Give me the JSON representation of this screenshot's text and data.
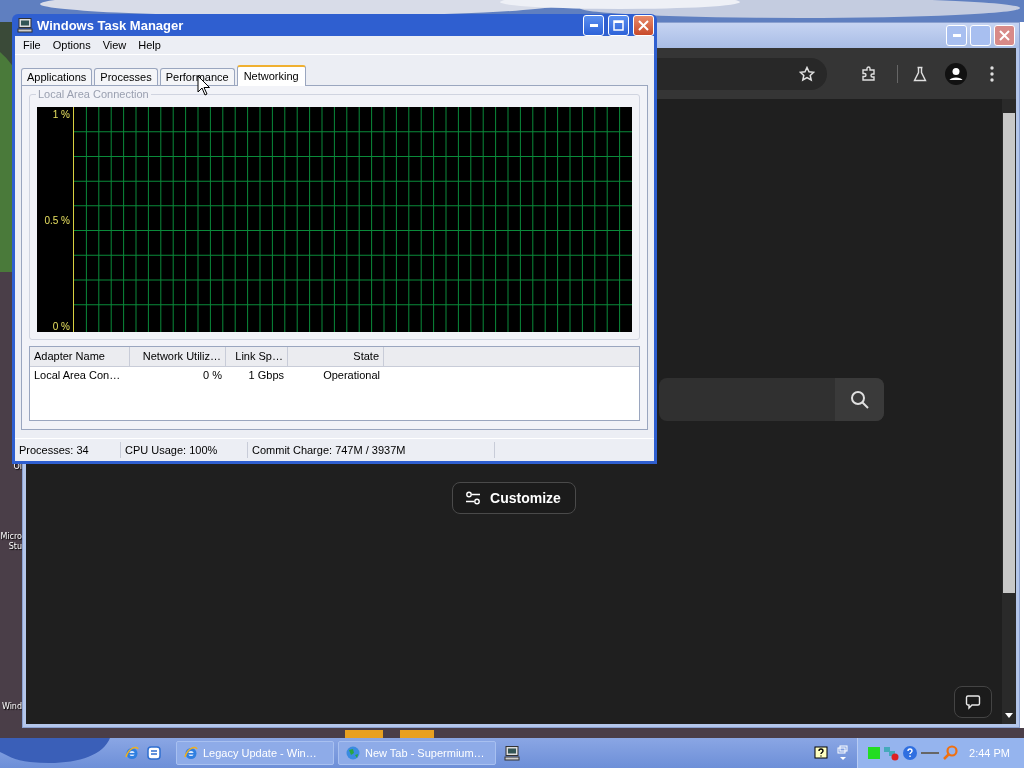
{
  "desktop_icons": [
    {
      "label": "Ol"
    },
    {
      "label": "Micro"
    },
    {
      "label": "Stu"
    },
    {
      "label": "Wind"
    }
  ],
  "browser": {
    "page": {
      "customize": "Customize"
    }
  },
  "task_manager": {
    "title": "Windows Task Manager",
    "menu": [
      "File",
      "Options",
      "View",
      "Help"
    ],
    "tabs": [
      {
        "label": "Applications",
        "selected": false
      },
      {
        "label": "Processes",
        "selected": false
      },
      {
        "label": "Performance",
        "selected": false
      },
      {
        "label": "Networking",
        "selected": true
      }
    ],
    "group_title": "Local Area Connection",
    "graph": {
      "y_labels": [
        "1 %",
        "0.5 %",
        "0 %"
      ]
    },
    "table": {
      "columns": [
        {
          "label": "Adapter Name"
        },
        {
          "label": "Network Utiliz…"
        },
        {
          "label": "Link Sp…"
        },
        {
          "label": "State"
        }
      ],
      "rows": [
        [
          "Local Area Con…",
          "0 %",
          "1 Gbps",
          "Operational"
        ]
      ]
    },
    "status_bar": [
      "Processes: 34",
      "CPU Usage: 100%",
      "Commit Charge: 747M / 3937M"
    ]
  },
  "taskbar": {
    "tasks": [
      {
        "label": "Legacy Update - Win…",
        "kind": "ie"
      },
      {
        "label": "New Tab - Supermium…",
        "kind": "globe"
      }
    ],
    "clock": "2:44 PM"
  }
}
